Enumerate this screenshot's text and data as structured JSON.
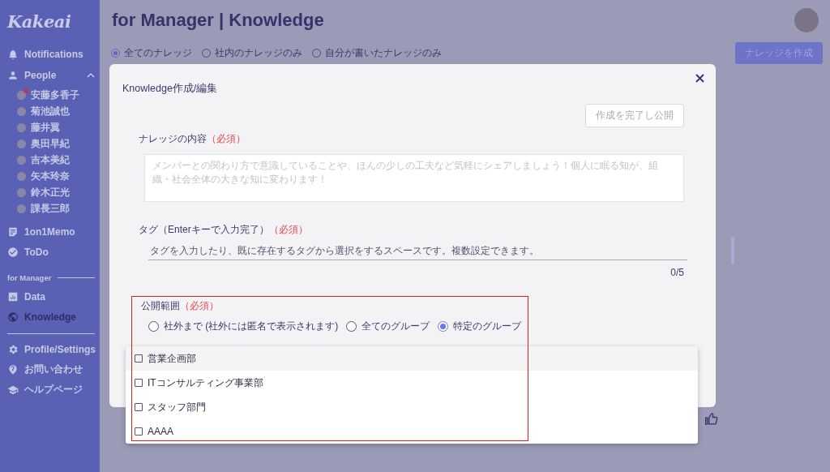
{
  "sidebar": {
    "logo": "Kakeai",
    "sections": [
      {
        "items": [
          {
            "kind": "link",
            "label": "Notifications",
            "selected": false
          },
          {
            "kind": "group",
            "label": "People",
            "expanded": true,
            "members": [
              {
                "name": "安藤多香子",
                "unread": true
              },
              {
                "name": "菊池誠也",
                "unread": false
              },
              {
                "name": "藤井翼",
                "unread": false
              },
              {
                "name": "奥田早紀",
                "unread": false
              },
              {
                "name": "吉本美紀",
                "unread": false
              },
              {
                "name": "矢本玲奈",
                "unread": false
              },
              {
                "name": "鈴木正光",
                "unread": false
              },
              {
                "name": "課長三郎",
                "unread": false
              }
            ]
          },
          {
            "kind": "link",
            "label": "1on1Memo",
            "selected": false
          },
          {
            "kind": "link",
            "label": "ToDo",
            "selected": false
          }
        ]
      },
      {
        "heading": "for Manager",
        "items": [
          {
            "kind": "link",
            "label": "Data",
            "selected": false
          },
          {
            "kind": "link",
            "label": "Knowledge",
            "selected": true
          }
        ]
      },
      {
        "items": [
          {
            "kind": "link",
            "label": "Profile/Settings",
            "selected": false
          },
          {
            "kind": "link",
            "label": "お問い合わせ",
            "selected": false
          },
          {
            "kind": "link",
            "label": "ヘルプページ",
            "selected": false
          }
        ]
      }
    ]
  },
  "page": {
    "title": "for Manager | Knowledge",
    "filters": [
      {
        "label": "全てのナレッジ",
        "selected": true
      },
      {
        "label": "社内のナレッジのみ",
        "selected": false
      },
      {
        "label": "自分が書いたナレッジのみ",
        "selected": false
      }
    ],
    "create_button": "ナレッジを作成"
  },
  "modal": {
    "title": "Knowledge作成/編集",
    "publish_button": {
      "label": "作成を完了し公開",
      "disabled": true
    },
    "content": {
      "label": "ナレッジの内容",
      "required": "（必須）",
      "placeholder": "メンバーとの関わり方で意識していることや、ほんの少しの工夫など気軽にシェアしましょう！個人に眠る知が、組織・社会全体の大きな知に変わります！"
    },
    "tags": {
      "label": "タグ（Enterキーで入力完了）",
      "required": "（必須）",
      "placeholder": "タグを入力したり、既に存在するタグから選択をするスペースです。複数設定できます。",
      "count": "0/5"
    },
    "scope": {
      "label": "公開範囲",
      "required": "（必須）",
      "options": [
        {
          "label": "社外まで (社外には匿名で表示されます)",
          "selected": false
        },
        {
          "label": "全てのグループ",
          "selected": false
        },
        {
          "label": "特定のグループ",
          "selected": true
        }
      ]
    },
    "groups": [
      {
        "label": "営業企画部",
        "checked": false,
        "highlighted": true
      },
      {
        "label": "ITコンサルティング事業部",
        "checked": false,
        "highlighted": false
      },
      {
        "label": "スタッフ部門",
        "checked": false,
        "highlighted": false
      },
      {
        "label": "AAAA",
        "checked": false,
        "highlighted": false
      }
    ]
  }
}
